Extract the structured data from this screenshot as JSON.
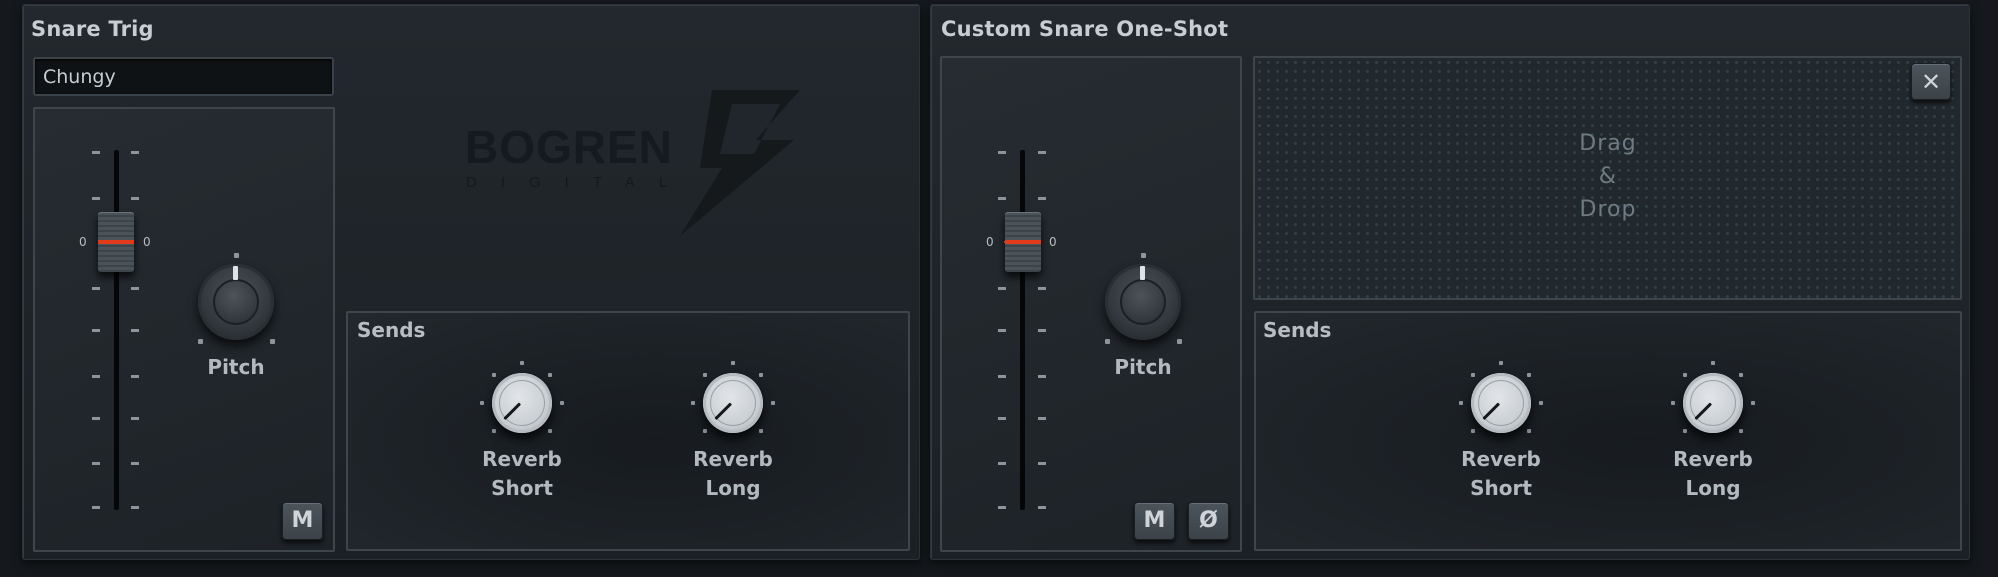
{
  "colors": {
    "accent_red": "#e33a1a",
    "panel_bg": "#1e2328",
    "text": "#b7bec3"
  },
  "left_panel": {
    "title": "Snare Trig",
    "preset_value": "Chungy",
    "fader": {
      "value_label_left": "0",
      "value_label_right": "0",
      "position": 0.25
    },
    "pitch": {
      "label": "Pitch",
      "value": 0.5
    },
    "mute_label": "M",
    "logo": {
      "brand": "BOGREN",
      "sub": "DIGITAL",
      "icon": "lightning-bolt-icon"
    },
    "sends": {
      "label": "Sends",
      "knobs": [
        {
          "label_line1": "Reverb",
          "label_line2": "Short",
          "value": 0.0
        },
        {
          "label_line1": "Reverb",
          "label_line2": "Long",
          "value": 0.0
        }
      ]
    }
  },
  "right_panel": {
    "title": "Custom Snare One-Shot",
    "fader": {
      "value_label_left": "0",
      "value_label_right": "0",
      "position": 0.25
    },
    "pitch": {
      "label": "Pitch",
      "value": 0.5
    },
    "mute_label": "M",
    "phase_label": "Ø",
    "dropzone": {
      "text": "Drag\n&\nDrop",
      "close_label": "✕"
    },
    "sends": {
      "label": "Sends",
      "knobs": [
        {
          "label_line1": "Reverb",
          "label_line2": "Short",
          "value": 0.0
        },
        {
          "label_line1": "Reverb",
          "label_line2": "Long",
          "value": 0.0
        }
      ]
    }
  }
}
